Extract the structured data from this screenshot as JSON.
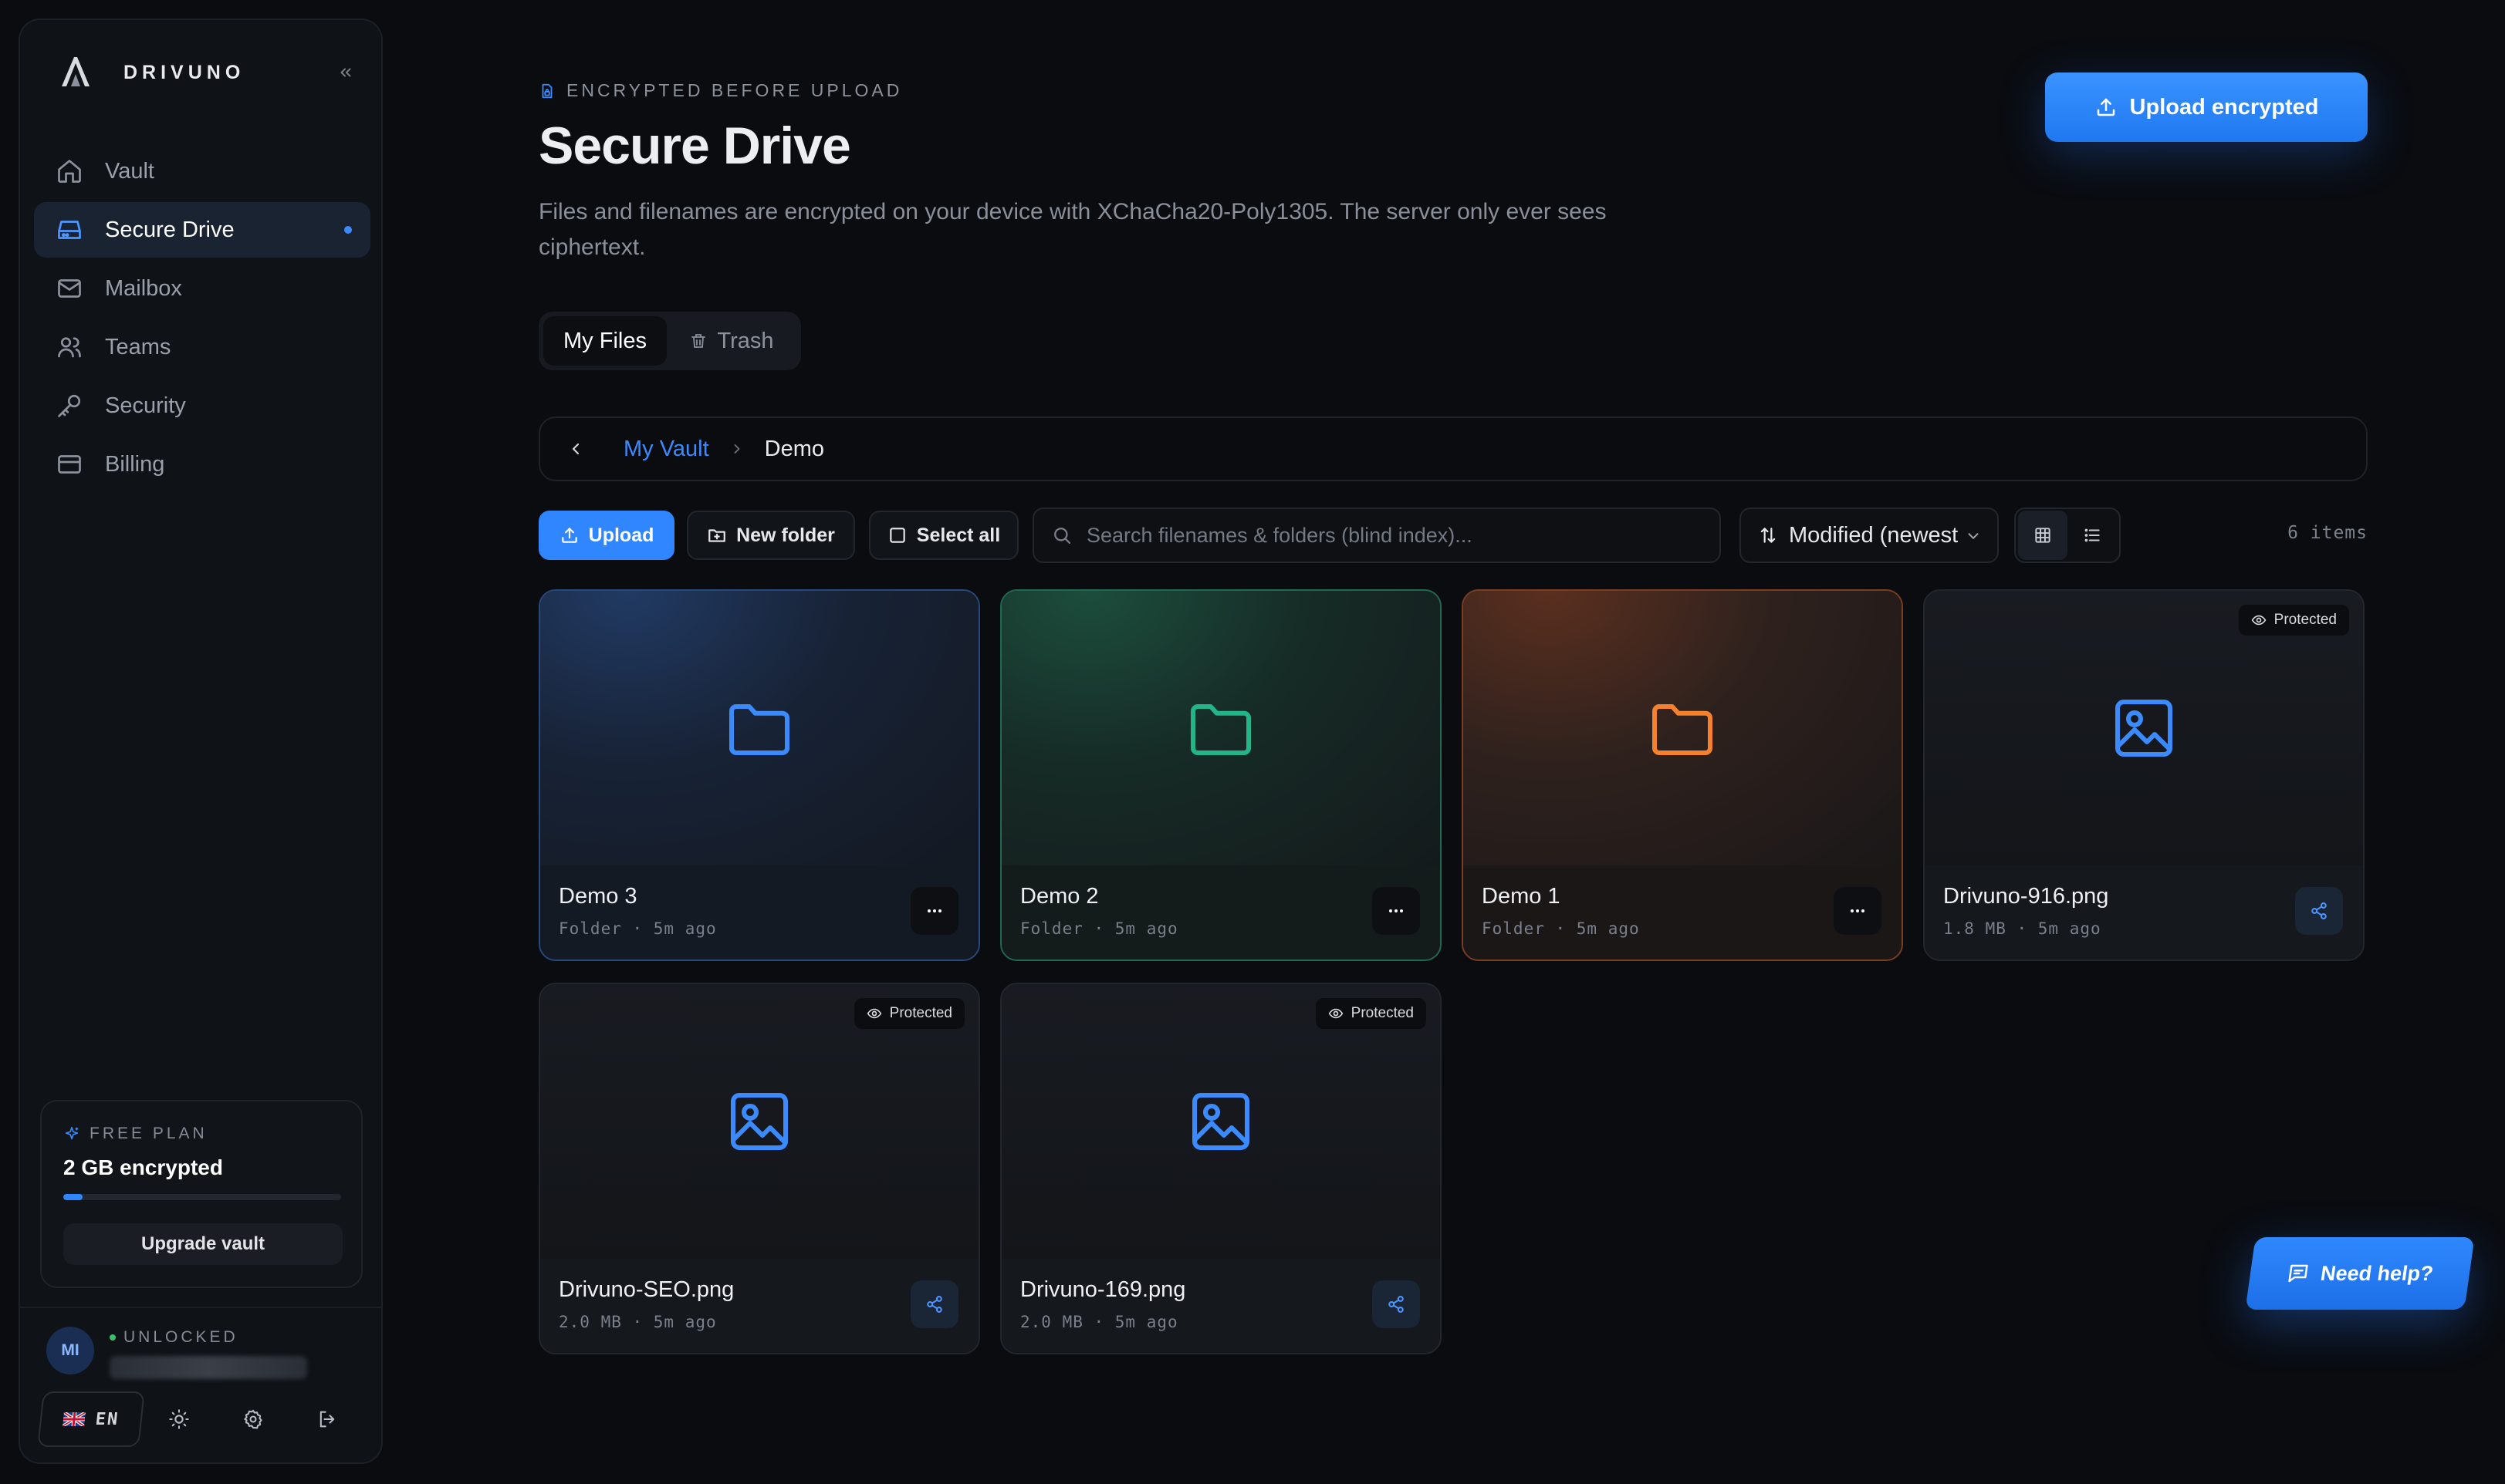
{
  "brand": {
    "name": "DRIVUNO"
  },
  "sidebar": {
    "items": [
      {
        "label": "Vault",
        "icon": "home-icon"
      },
      {
        "label": "Secure Drive",
        "icon": "drive-icon",
        "active": true
      },
      {
        "label": "Mailbox",
        "icon": "mail-icon"
      },
      {
        "label": "Teams",
        "icon": "users-icon"
      },
      {
        "label": "Security",
        "icon": "key-icon"
      },
      {
        "label": "Billing",
        "icon": "credit-card-icon"
      }
    ],
    "plan": {
      "label": "FREE PLAN",
      "storage": "2 GB encrypted",
      "usage_fraction": 0.07,
      "upgrade_label": "Upgrade vault"
    },
    "user": {
      "initials": "MI",
      "status": "UNLOCKED",
      "language": "EN"
    }
  },
  "header": {
    "eyebrow": "ENCRYPTED BEFORE UPLOAD",
    "title": "Secure Drive",
    "description": "Files and filenames are encrypted on your device with XChaCha20-Poly1305. The server only ever sees ciphertext.",
    "upload_button": "Upload encrypted"
  },
  "tabs": [
    {
      "label": "My Files",
      "active": true
    },
    {
      "label": "Trash",
      "active": false
    }
  ],
  "breadcrumb": {
    "root": "My Vault",
    "current": "Demo"
  },
  "toolbar": {
    "upload": "Upload",
    "new_folder": "New folder",
    "select_all": "Select all",
    "search_placeholder": "Search filenames & folders (blind index)...",
    "sort": "Modified (newest first)",
    "items_count": "6 items"
  },
  "cards": [
    {
      "name": "Demo 3",
      "meta": "Folder · 5m ago",
      "type": "folder",
      "color": "#3b8bff"
    },
    {
      "name": "Demo 2",
      "meta": "Folder · 5m ago",
      "type": "folder",
      "color": "#23b489"
    },
    {
      "name": "Demo 1",
      "meta": "Folder · 5m ago",
      "type": "folder",
      "color": "#f5812d"
    },
    {
      "name": "Drivuno-916.png",
      "meta": "1.8 MB · 5m ago",
      "type": "image",
      "badge": "Protected",
      "color": "#3b8bff"
    },
    {
      "name": "Drivuno-SEO.png",
      "meta": "2.0 MB · 5m ago",
      "type": "image",
      "badge": "Protected",
      "color": "#3b8bff"
    },
    {
      "name": "Drivuno-169.png",
      "meta": "2.0 MB · 5m ago",
      "type": "image",
      "badge": "Protected",
      "color": "#3b8bff"
    }
  ],
  "help": {
    "label": "Need help?"
  }
}
